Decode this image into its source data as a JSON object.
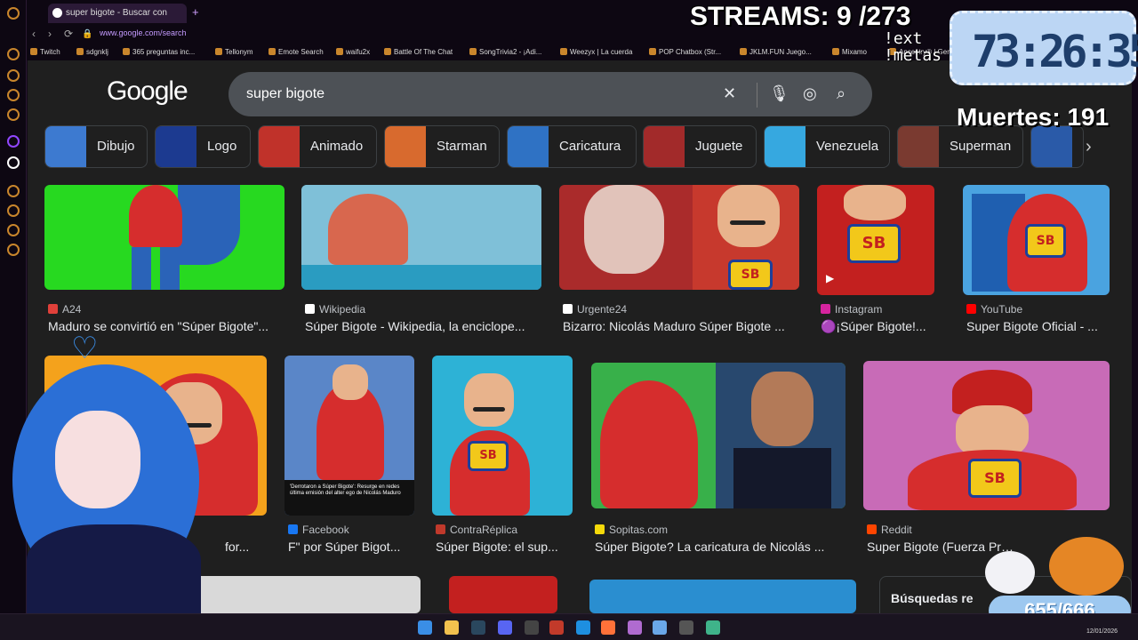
{
  "browser": {
    "tab_title": "super bigote - Buscar con",
    "new_tab": "+",
    "url": "www.google.com/search",
    "bookmarks": [
      "Twitch",
      "sdgnklj",
      "365 preguntas inc...",
      "Tellonym",
      "Emote Search",
      "waifu2x",
      "Battle Of The Chat",
      "SongTrivia2 - ¡Adi...",
      "Weezyx | La cuerda",
      "POP Chatbox (Str...",
      "JKLM.FUN Juego...",
      "Mixamo",
      "Ancestry® | Gen"
    ]
  },
  "google": {
    "logo": "Google",
    "query": "super bigote",
    "chips": [
      "Dibujo",
      "Logo",
      "Animado",
      "Starman",
      "Caricatura",
      "Juguete",
      "Venezuela",
      "Superman"
    ],
    "row1": [
      {
        "source": "A24",
        "title": "Maduro se convirtió en \"Súper Bigote\"...",
        "src_color": "#e0403a"
      },
      {
        "source": "Wikipedia",
        "title": "Súper Bigote - Wikipedia, la enciclope...",
        "src_color": "#ffffff"
      },
      {
        "source": "Urgente24",
        "title": "Bizarro: Nicolás Maduro Súper Bigote ...",
        "src_color": "#ffffff"
      },
      {
        "source": "Instagram",
        "title": "🟣¡Súper Bigote!...",
        "src_color": "#d6249f"
      },
      {
        "source": "YouTube",
        "title": "Super Bigote Oficial - ...",
        "src_color": "#ff0000"
      }
    ],
    "row2": [
      {
        "source": "",
        "title": "for...",
        "src_color": "#888888"
      },
      {
        "source": "Facebook",
        "title": "F\" por Súper Bigot...",
        "src_color": "#1877f2"
      },
      {
        "source": "ContraRéplica",
        "title": "Súper Bigote: el sup...",
        "src_color": "#c0392b"
      },
      {
        "source": "Sopitas.com",
        "title": "Súper Bigote? La caricatura de Nicolás ...",
        "src_color": "#f5d90a"
      },
      {
        "source": "Reddit",
        "title": "Super Bigote (Fuerza Presidente",
        "src_color": "#ff4500"
      }
    ],
    "fb_caption": "'Derrotaron a Súper Bigote': Resurge en redes última emisión del alter ego de Nicolás Maduro",
    "related": "Búsquedas re",
    "emblem": "SB"
  },
  "overlay": {
    "streams": "STREAMS: 9 /273",
    "commands": [
      "!ext",
      "!metas"
    ],
    "timer": "73:26:35",
    "deaths": "Muertes: 191",
    "counter": "655/666"
  },
  "taskbar": {
    "date": "12/01/2026"
  }
}
